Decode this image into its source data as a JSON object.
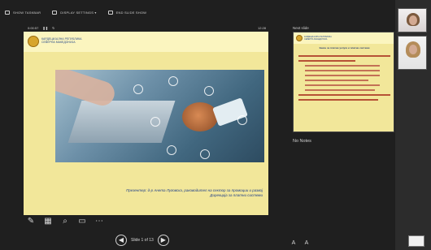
{
  "toolbar": {
    "items": [
      {
        "label": "SHOW TASKBAR"
      },
      {
        "label": "DISPLAY SETTINGS ▾"
      },
      {
        "label": "END SLIDE SHOW"
      }
    ]
  },
  "presenter_bar": {
    "timer": "0:00:57",
    "clock": "12:28"
  },
  "main_slide": {
    "organization": "КАРДЕЦИЈАЛНА\nРЕПУБЛИКА СЕВЕРНА МАКЕДОНИЈА",
    "presenter_line_1": "Презентер: д-р Анета Луговска, раководител на сектор за промоции и развој",
    "presenter_line_2": "Дирекција за платни системи"
  },
  "pager": {
    "text": "Slide 1 of 13"
  },
  "next_slide": {
    "label": "Next slide",
    "organization": "КАРДЕЦИЈАЛНА\nРЕПУБЛИКА СЕВЕРНА МАКЕДОНИЈА",
    "title": "Закон за платни услуги и платни системи"
  },
  "notes": {
    "text": "No Notes"
  },
  "icons": {
    "pen": "pen-icon",
    "slides": "slide-grid-icon",
    "zoom": "magnifier-icon",
    "screen": "screen-icon",
    "more": "more-icon",
    "prev": "chevron-left-icon",
    "next": "chevron-right-icon"
  }
}
